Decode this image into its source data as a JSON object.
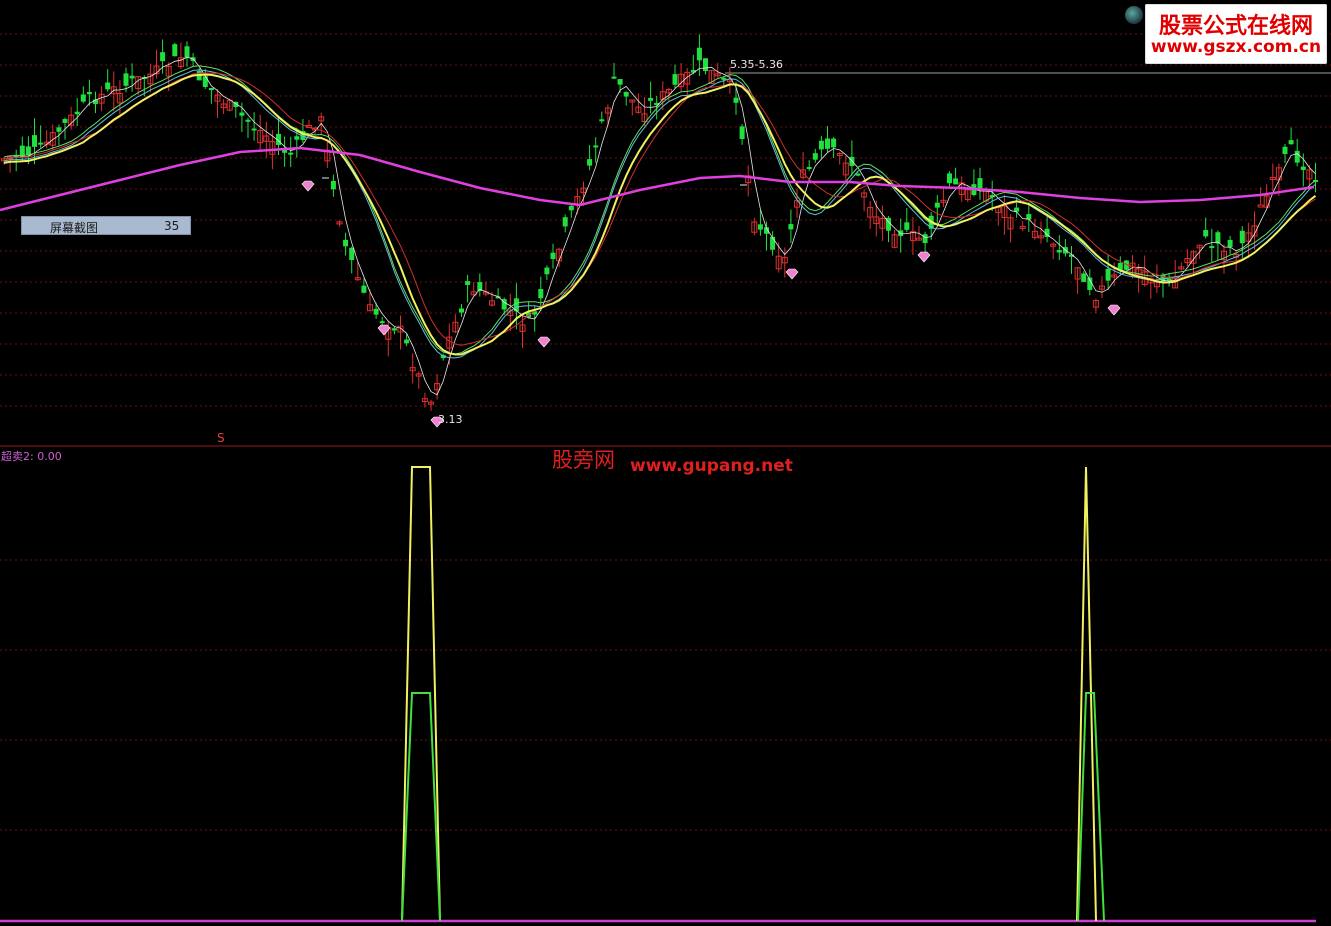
{
  "watermark_top": {
    "title": "股票公式在线网",
    "url": "www.gszx.com.cn"
  },
  "watermark_mid": {
    "brand": "股旁网",
    "url": "www.gupang.net"
  },
  "screenshot_button": {
    "label": "屏幕截图",
    "value": "35"
  },
  "price_labels": {
    "high": "5.35-5.36",
    "low": "3.13",
    "signal_s": "S"
  },
  "indicator": {
    "label": "超卖2: 0.00"
  },
  "colors": {
    "background": "#000000",
    "up": "#e03030",
    "down": "#20e040",
    "ma_slow": "#e040e0",
    "ma_yellow": "#f0f060",
    "ma_white": "#e8e8e8",
    "ma_cyan": "#60c0e0",
    "ma_green": "#60e060",
    "ma_red": "#d03030",
    "grid": "#6a1010",
    "diamond": "#f080d0",
    "ind_yellow": "#f0f060",
    "ind_green": "#40e040",
    "ind_base": "#d040d0"
  },
  "icons": {
    "diamond": "diamond-icon",
    "logo": "globe-logo-icon"
  }
}
